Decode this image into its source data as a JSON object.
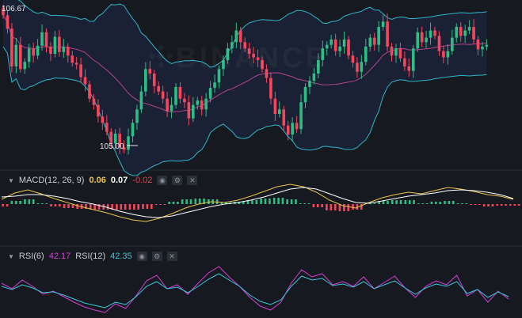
{
  "watermark": "BINANCE",
  "price_panel": {
    "high_label": "106.67",
    "low_label": "105.00"
  },
  "macd_header": {
    "title": "MACD(12, 26, 9)",
    "dif": "0.06",
    "dea": "0.07",
    "hist": "-0.02",
    "colors": {
      "dif": "#e8c54a",
      "dea": "#ffffff",
      "hist": "#e0455a"
    }
  },
  "rsi_header": {
    "rsi6_label": "RSI(6)",
    "rsi6": "42.17",
    "rsi12_label": "RSI(12)",
    "rsi12": "42.35",
    "colors": {
      "rsi6": "#d43fd4",
      "rsi12": "#39c6d8"
    }
  },
  "colors": {
    "up": "#2ebd85",
    "down": "#f6465d",
    "band": "#2fb6c8",
    "mid": "#b0458f",
    "bg": "#16191f"
  },
  "chart_data": [
    {
      "type": "candlestick",
      "title": "",
      "labels": [
        "106.67",
        "105.00"
      ],
      "ylim": [
        104.85,
        106.72
      ],
      "series": {
        "close": [
          106.55,
          106.4,
          105.98,
          106.22,
          105.95,
          106.03,
          106.18,
          106.1,
          106.21,
          106.36,
          106.2,
          106.12,
          106.31,
          106.14,
          106.2,
          106.1,
          106.02,
          106.0,
          105.86,
          105.78,
          105.62,
          105.55,
          105.42,
          105.35,
          105.25,
          105.12,
          105.23,
          105.08,
          105.05,
          105.2,
          105.35,
          105.5,
          105.7,
          105.95,
          105.9,
          105.76,
          105.7,
          105.62,
          105.48,
          105.55,
          105.75,
          105.62,
          105.58,
          105.4,
          105.55,
          105.6,
          105.5,
          105.62,
          105.74,
          105.8,
          105.95,
          106.05,
          106.18,
          106.25,
          106.38,
          106.25,
          106.18,
          106.12,
          106.08,
          106.05,
          105.95,
          105.85,
          105.62,
          105.45,
          105.5,
          105.32,
          105.22,
          105.35,
          105.28,
          105.58,
          105.75,
          105.82,
          105.9,
          106.05,
          106.18,
          106.22,
          106.28,
          106.15,
          106.2,
          106.28,
          106.1,
          106.02,
          105.92,
          106.03,
          106.2,
          106.3,
          106.22,
          106.42,
          106.48,
          106.2,
          106.1,
          106.18,
          106.07,
          105.98,
          105.93,
          106.18,
          106.36,
          106.25,
          106.3,
          106.38,
          106.32,
          106.15,
          106.08,
          106.15,
          106.3,
          106.42,
          106.32,
          106.38,
          106.42,
          106.28,
          106.17,
          106.2,
          106.22
        ],
        "volume_note": ""
      }
    },
    {
      "type": "line",
      "title": "",
      "series": [
        {
          "name": "DIF",
          "values": [
            0.06,
            0.14,
            0.18,
            0.13,
            0.07,
            0.02,
            -0.03,
            -0.07,
            -0.11,
            -0.16,
            -0.2,
            -0.22,
            -0.18,
            -0.12,
            -0.05,
            0.0,
            0.03,
            0.02,
            0.05,
            0.1,
            0.16,
            0.22,
            0.25,
            0.22,
            0.15,
            0.05,
            -0.02,
            -0.05,
            0.02,
            0.08,
            0.12,
            0.15,
            0.13,
            0.17,
            0.21,
            0.19,
            0.16,
            0.12,
            0.1,
            0.06
          ]
        },
        {
          "name": "DEA",
          "values": [
            0.09,
            0.1,
            0.12,
            0.12,
            0.1,
            0.07,
            0.03,
            0.0,
            -0.04,
            -0.09,
            -0.13,
            -0.16,
            -0.17,
            -0.15,
            -0.11,
            -0.07,
            -0.03,
            0.0,
            0.02,
            0.05,
            0.09,
            0.14,
            0.19,
            0.21,
            0.19,
            0.13,
            0.07,
            0.02,
            0.01,
            0.04,
            0.07,
            0.1,
            0.12,
            0.14,
            0.17,
            0.18,
            0.17,
            0.15,
            0.12,
            0.07
          ]
        },
        {
          "name": "Histogram",
          "values": [
            -0.03,
            0.04,
            0.06,
            0.01,
            -0.03,
            -0.05,
            -0.06,
            -0.07,
            -0.07,
            -0.07,
            -0.07,
            -0.06,
            -0.01,
            0.03,
            0.06,
            0.07,
            0.06,
            0.02,
            0.03,
            0.05,
            0.07,
            0.08,
            0.06,
            0.01,
            -0.04,
            -0.08,
            -0.09,
            -0.07,
            0.01,
            0.04,
            0.05,
            0.05,
            0.01,
            0.03,
            0.04,
            0.01,
            -0.01,
            -0.03,
            -0.02,
            -0.02
          ]
        }
      ]
    },
    {
      "type": "line",
      "title": "",
      "series": [
        {
          "name": "RSI(6)",
          "values": [
            62,
            55,
            66,
            58,
            48,
            52,
            45,
            38,
            32,
            28,
            25,
            36,
            30,
            46,
            65,
            72,
            55,
            60,
            48,
            62,
            75,
            83,
            70,
            58,
            44,
            33,
            28,
            38,
            62,
            79,
            70,
            74,
            60,
            64,
            58,
            70,
            55,
            63,
            71,
            56,
            44,
            58,
            65,
            60,
            72,
            46,
            54,
            38,
            52,
            42
          ]
        },
        {
          "name": "RSI(12)",
          "values": [
            58,
            54,
            60,
            56,
            50,
            51,
            47,
            42,
            37,
            34,
            31,
            38,
            35,
            45,
            58,
            64,
            55,
            57,
            50,
            58,
            67,
            74,
            66,
            58,
            47,
            39,
            35,
            41,
            58,
            71,
            66,
            68,
            59,
            61,
            57,
            64,
            55,
            60,
            65,
            56,
            48,
            56,
            61,
            58,
            64,
            49,
            54,
            44,
            51,
            45
          ]
        }
      ]
    }
  ]
}
